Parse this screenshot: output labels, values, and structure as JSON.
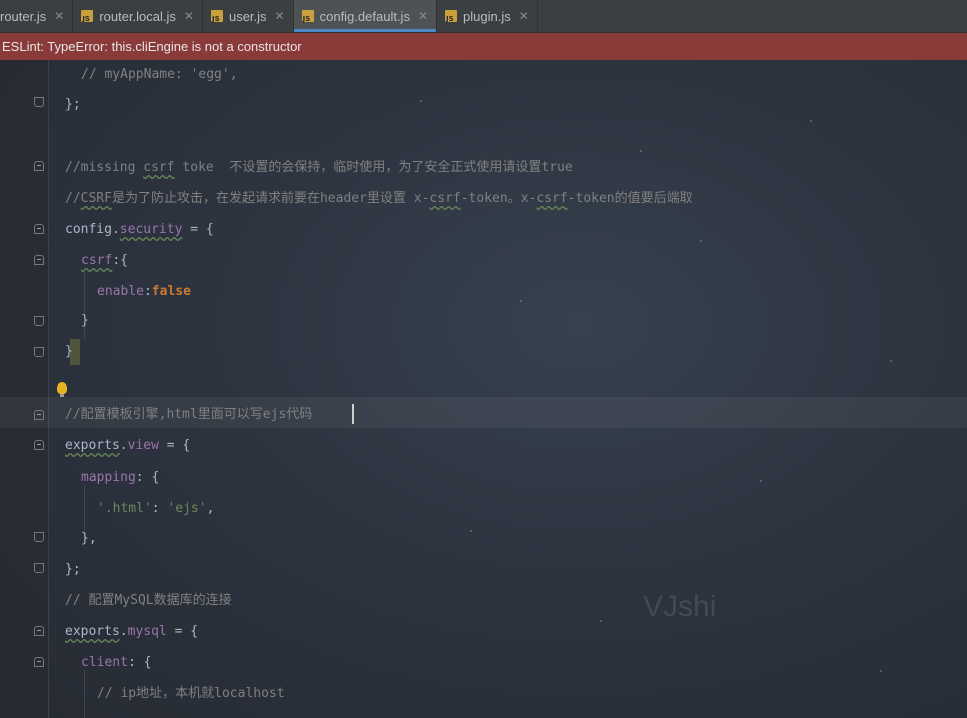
{
  "tabs": [
    {
      "label": "router.js",
      "active": false
    },
    {
      "label": "router.local.js",
      "active": false
    },
    {
      "label": "user.js",
      "active": false
    },
    {
      "label": "config.default.js",
      "active": true
    },
    {
      "label": "plugin.js",
      "active": false
    }
  ],
  "error_message": "ESLint: TypeError: this.cliEngine is not a constructor",
  "code": {
    "l1": "// myAppName: 'egg',",
    "l2": "};",
    "l3_a": "//missing ",
    "l3_b": "csrf",
    "l3_c": " toke  不设置的会保持，临时使用，为了安全正式使用请设置true",
    "l4_a": "//",
    "l4_b": "CSRF",
    "l4_c": "是为了防止攻击，在发起请求前要在header里设置 x-",
    "l4_d": "csrf",
    "l4_e": "-token。x-",
    "l4_f": "csrf",
    "l4_g": "-token的值要后端取",
    "l5_a": "config.",
    "l5_b": "security",
    "l5_c": " = {",
    "l6_a": "csrf",
    "l6_b": ":{",
    "l7_a": "enable",
    "l7_b": ":",
    "l7_c": "false",
    "l8": "}",
    "l9": "}",
    "l10": "//配置模板引擎,html里面可以写ejs代码",
    "l11_a": "exports",
    "l11_b": ".",
    "l11_c": "view",
    "l11_d": " = {",
    "l12_a": "mapping",
    "l12_b": ": {",
    "l13_a": "'.html'",
    "l13_b": ": ",
    "l13_c": "'ejs'",
    "l13_d": ",",
    "l14": "},",
    "l15": "};",
    "l16": "// 配置MySQL数据库的连接",
    "l17_a": "exports",
    "l17_b": ".",
    "l17_c": "mysql",
    "l17_d": " = {",
    "l18_a": "client",
    "l18_b": ": {",
    "l19": "// ip地址，本机就localhost"
  },
  "watermark": "VJshi",
  "colors": {
    "error_bar": "#8b3a3a",
    "active_tab_underline": "#4a88c7",
    "keyword": "#cc7832",
    "string": "#6a8759",
    "property": "#9876aa",
    "comment": "#808080"
  }
}
